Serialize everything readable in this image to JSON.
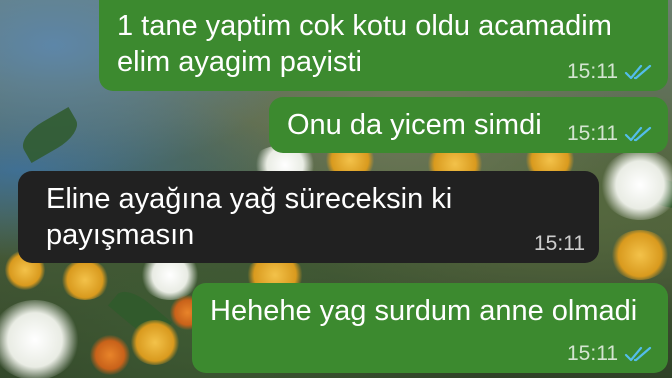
{
  "conversation": {
    "messages": [
      {
        "direction": "outgoing",
        "text": "1 tane yaptim cok kotu oldu acamadim\nelim ayagim payisti",
        "time": "15:11",
        "status": "read"
      },
      {
        "direction": "outgoing",
        "text": "Onu da yicem simdi",
        "time": "15:11",
        "status": "read"
      },
      {
        "direction": "incoming",
        "text": "Eline ayağına yağ süreceksin ki\npayışmasın",
        "time": "15:11"
      },
      {
        "direction": "outgoing",
        "text": "Hehehe yag surdum anne olmadi",
        "time": "15:11",
        "status": "read"
      }
    ]
  },
  "colors": {
    "outgoing_bubble": "#3c8a2f",
    "incoming_bubble": "#212121",
    "read_ticks": "#53bdeb",
    "text": "#ffffff"
  },
  "icons": {
    "read_receipt": "double-check-icon",
    "wallpaper": "flower-garden-wallpaper"
  }
}
